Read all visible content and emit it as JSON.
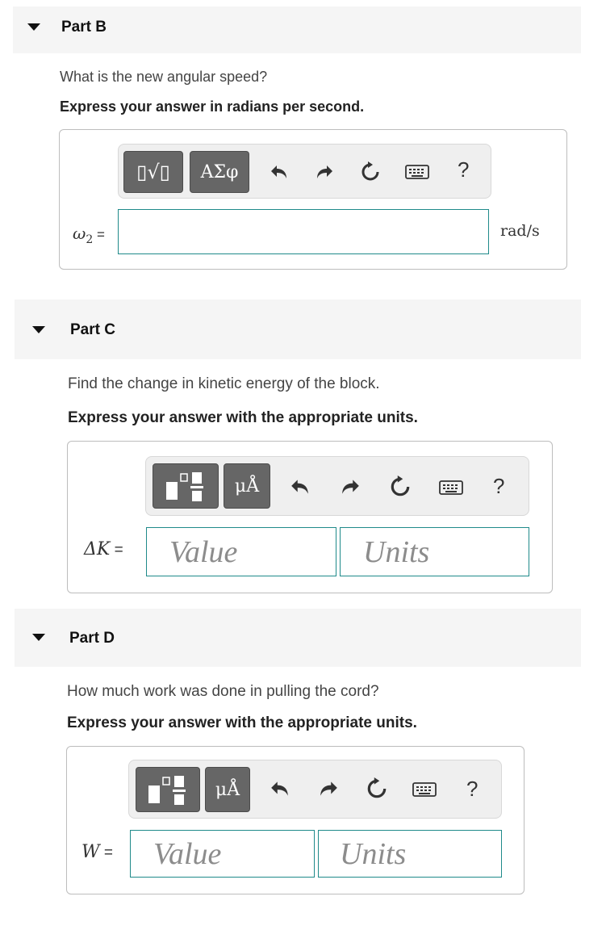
{
  "part_b": {
    "title": "Part B",
    "question": "What is the new angular speed?",
    "instruction": "Express your answer in radians per second.",
    "toolbar": {
      "template_label": "▯√▯",
      "symbols_label": "ΑΣφ",
      "help_label": "?"
    },
    "variable": "ω",
    "variable_sub": "2",
    "equals": " =",
    "unit": "rad/s",
    "input_value": ""
  },
  "part_c": {
    "title": "Part C",
    "question": "Find the change in kinetic energy of the block.",
    "instruction": "Express your answer with the appropriate units.",
    "toolbar": {
      "units_label": "μÅ",
      "help_label": "?"
    },
    "variable": "ΔK",
    "equals": " =",
    "value_placeholder": "Value",
    "units_placeholder": "Units"
  },
  "part_d": {
    "title": "Part D",
    "question": "How much work was done in pulling the cord?",
    "instruction": "Express your answer with the appropriate units.",
    "toolbar": {
      "units_label": "μÅ",
      "help_label": "?"
    },
    "variable": "W",
    "equals": " =",
    "value_placeholder": "Value",
    "units_placeholder": "Units"
  },
  "icons": [
    "collapse-caret-icon",
    "undo-icon",
    "redo-icon",
    "reset-icon",
    "keyboard-icon",
    "help-icon",
    "fraction-template-icon"
  ],
  "colors": {
    "header_bg": "#f5f5f5",
    "button_bg": "#666666",
    "input_border": "#1f8a8a"
  }
}
